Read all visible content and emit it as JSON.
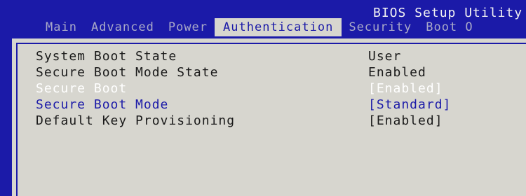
{
  "header": {
    "title": "BIOS Setup Utility"
  },
  "tabs": [
    {
      "label": "Main"
    },
    {
      "label": "Advanced"
    },
    {
      "label": "Power"
    },
    {
      "label": "Authentication"
    },
    {
      "label": "Security"
    },
    {
      "label": "Boot O"
    }
  ],
  "settings": [
    {
      "label": "System Boot State",
      "value": "User"
    },
    {
      "label": "Secure Boot Mode State",
      "value": "Enabled"
    },
    {
      "label": "Secure Boot",
      "value": "[Enabled]"
    },
    {
      "label": "Secure Boot Mode",
      "value": "[Standard]"
    },
    {
      "label": "Default Key Provisioning",
      "value": "[Enabled]"
    }
  ],
  "colors": {
    "background": "#1b1aa8",
    "panel": "#d7d6cf",
    "text": "#1a1a1a",
    "selected_text": "#ffffff",
    "highlight_text": "#1b1aa8"
  }
}
